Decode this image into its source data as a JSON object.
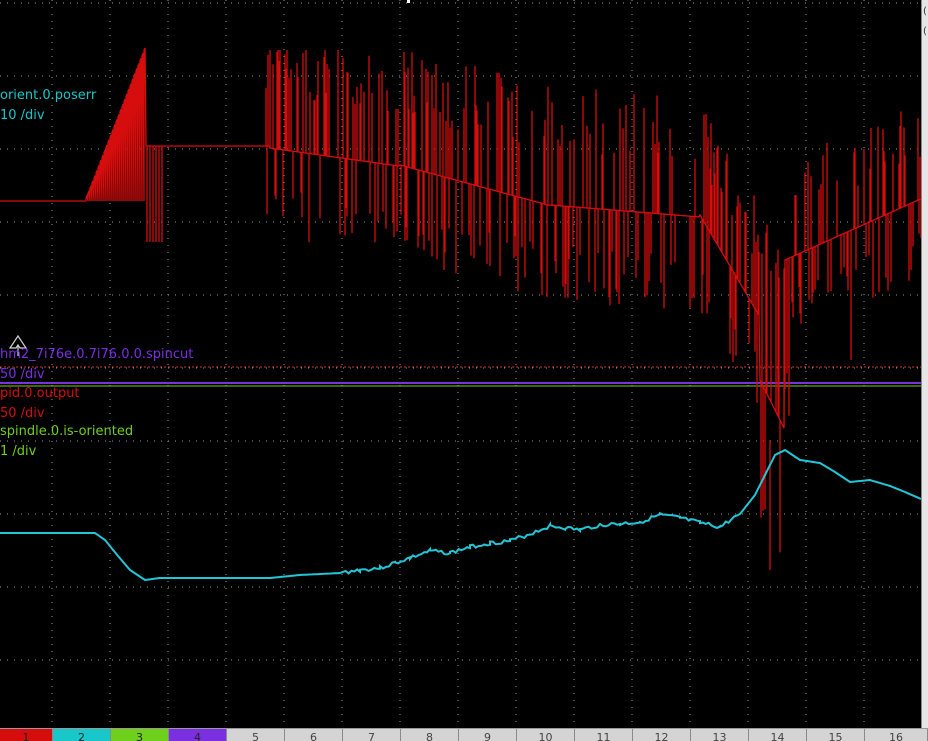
{
  "traces": [
    {
      "id": "orient",
      "name": "orient.0.poserr",
      "scale": "10 /div",
      "color": "#17c7c9"
    },
    {
      "id": "spincut",
      "name": "hm2_7i76e.0.7i76.0.0.spincut",
      "scale": "50 /div",
      "color": "#7a2fe0"
    },
    {
      "id": "pid",
      "name": "pid.0.output",
      "scale": "50 /div",
      "color": "#d60d0d"
    },
    {
      "id": "oriented",
      "name": "spindle.0.is-oriented",
      "scale": "1 /div",
      "color": "#6ed01a"
    }
  ],
  "colors": {
    "background": "#000000",
    "grid": "#9a9a9a",
    "red": "#d60d0d",
    "cyan": "#22c6d6",
    "purple": "#7a2fe0",
    "green": "#6ed01a",
    "trigger": "#cc3333"
  },
  "channels": [
    {
      "label": "1",
      "color": "#d60d0d"
    },
    {
      "label": "2",
      "color": "#17c7c9"
    },
    {
      "label": "3",
      "color": "#6ed01a"
    },
    {
      "label": "4",
      "color": "#7a2fe0"
    },
    {
      "label": "5",
      "color": ""
    },
    {
      "label": "6",
      "color": ""
    },
    {
      "label": "7",
      "color": ""
    },
    {
      "label": "8",
      "color": ""
    },
    {
      "label": "9",
      "color": ""
    },
    {
      "label": "10",
      "color": ""
    },
    {
      "label": "11",
      "color": ""
    },
    {
      "label": "12",
      "color": ""
    },
    {
      "label": "13",
      "color": ""
    },
    {
      "label": "14",
      "color": ""
    },
    {
      "label": "15",
      "color": ""
    },
    {
      "label": "16",
      "color": ""
    }
  ],
  "right_marks": [
    "(",
    "("
  ]
}
